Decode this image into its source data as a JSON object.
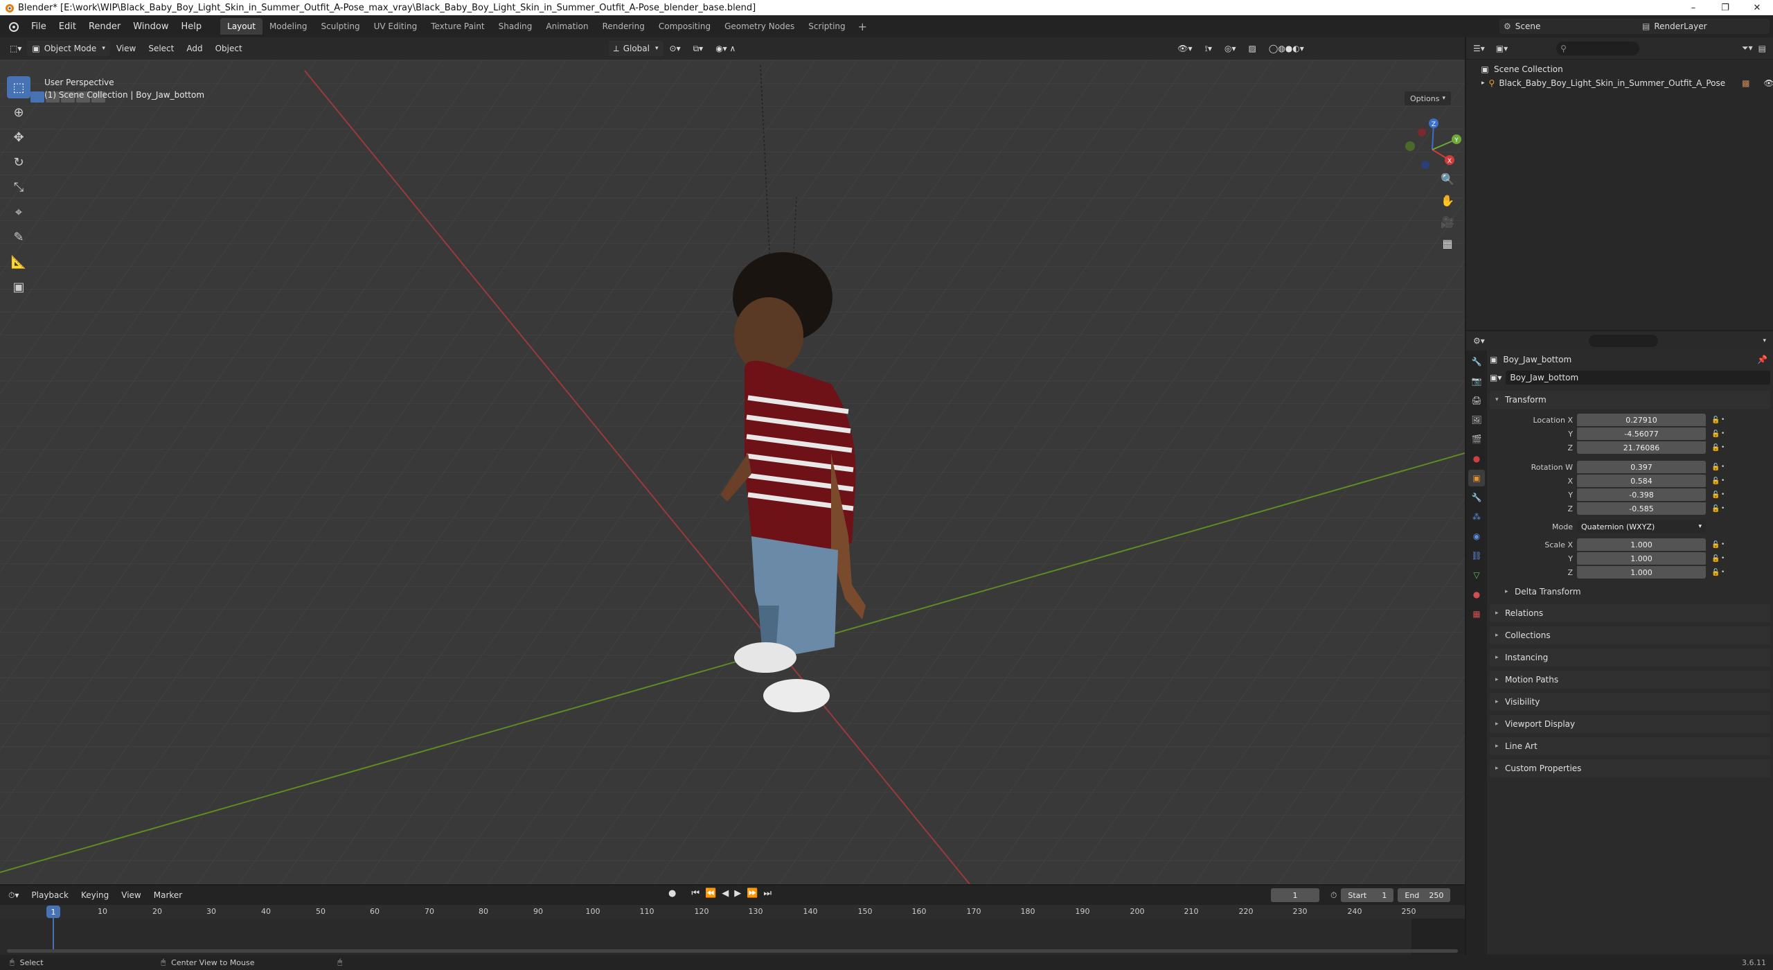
{
  "window": {
    "title": "Blender* [E:\\work\\WIP\\Black_Baby_Boy_Light_Skin_in_Summer_Outfit_A-Pose_max_vray\\Black_Baby_Boy_Light_Skin_in_Summer_Outfit_A-Pose_blender_base.blend]"
  },
  "menu": [
    "File",
    "Edit",
    "Render",
    "Window",
    "Help"
  ],
  "workspaces": [
    "Layout",
    "Modeling",
    "Sculpting",
    "UV Editing",
    "Texture Paint",
    "Shading",
    "Animation",
    "Rendering",
    "Compositing",
    "Geometry Nodes",
    "Scripting"
  ],
  "active_workspace": "Layout",
  "scene_name": "Scene",
  "render_layer": "RenderLayer",
  "viewport": {
    "mode": "Object Mode",
    "menus": [
      "View",
      "Select",
      "Add",
      "Object"
    ],
    "orientation": "Global",
    "options_label": "Options",
    "perspective": "User Perspective",
    "context": "(1) Scene Collection | Boy_Jaw_bottom",
    "gizmo": {
      "x": "X",
      "y": "Y",
      "z": "Z"
    }
  },
  "outliner": {
    "root": "Scene Collection",
    "items": [
      "Black_Baby_Boy_Light_Skin_in_Summer_Outfit_A_Pose"
    ]
  },
  "properties": {
    "object_name": "Boy_Jaw_bottom",
    "data_name": "Boy_Jaw_bottom",
    "transform_label": "Transform",
    "location": {
      "label": "Location X",
      "x": "0.27910",
      "y": "-4.56077",
      "z": "21.76086"
    },
    "rotation": {
      "label": "Rotation W",
      "w": "0.397",
      "x": "0.584",
      "y": "-0.398",
      "z": "-0.585"
    },
    "mode": {
      "label": "Mode",
      "value": "Quaternion (WXYZ)"
    },
    "scale": {
      "label": "Scale X",
      "x": "1.000",
      "y": "1.000",
      "z": "1.000"
    },
    "axis_labels": {
      "x": "X",
      "y": "Y",
      "z": "Z"
    },
    "delta_transform": "Delta Transform",
    "panels": [
      "Relations",
      "Collections",
      "Instancing",
      "Motion Paths",
      "Visibility",
      "Viewport Display",
      "Line Art",
      "Custom Properties"
    ]
  },
  "timeline": {
    "menus": [
      "Playback",
      "Keying",
      "View",
      "Marker"
    ],
    "current_frame": "1",
    "start_label": "Start",
    "start": "1",
    "end_label": "End",
    "end": "250",
    "ruler": [
      "10",
      "20",
      "30",
      "40",
      "50",
      "60",
      "70",
      "80",
      "90",
      "100",
      "110",
      "120",
      "130",
      "140",
      "150",
      "160",
      "170",
      "180",
      "190",
      "200",
      "210",
      "220",
      "230",
      "240",
      "250"
    ]
  },
  "status": {
    "select": "Select",
    "center": "Center View to Mouse",
    "version": "3.6.11"
  },
  "colors": {
    "accent": "#4772b3",
    "x_axis": "#c23b3b",
    "y_axis": "#6b9a2a",
    "grid_bg": "#393939"
  }
}
